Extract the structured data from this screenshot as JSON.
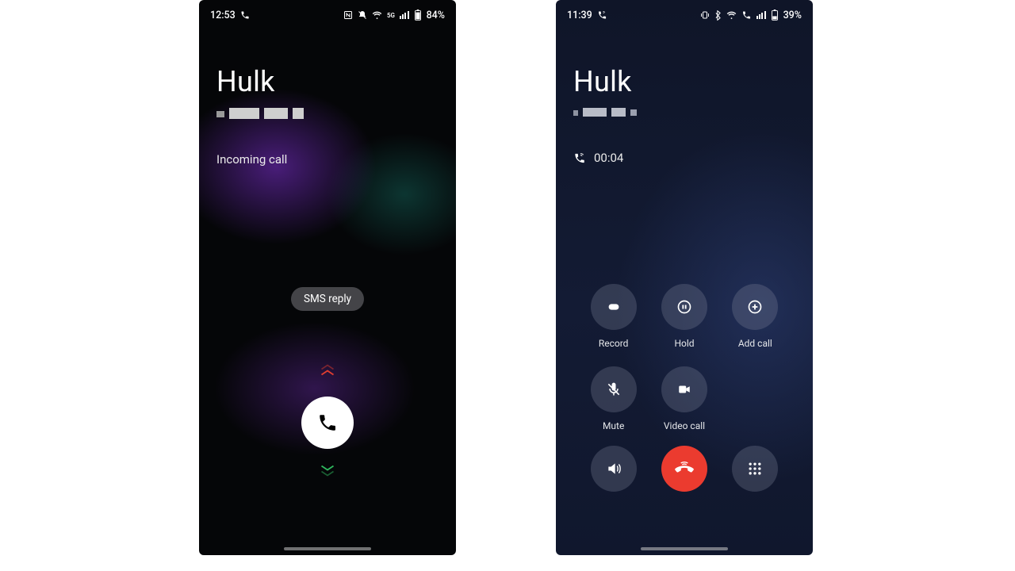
{
  "left": {
    "status": {
      "time": "12:53",
      "battery": "84%",
      "net_label": "5G"
    },
    "caller_name": "Hulk",
    "call_state": "Incoming call",
    "sms_reply_label": "SMS reply"
  },
  "right": {
    "status": {
      "time": "11:39",
      "battery": "39%"
    },
    "caller_name": "Hulk",
    "call_duration": "00:04",
    "controls": {
      "record": "Record",
      "hold": "Hold",
      "add_call": "Add call",
      "mute": "Mute",
      "video_call": "Video call"
    }
  }
}
